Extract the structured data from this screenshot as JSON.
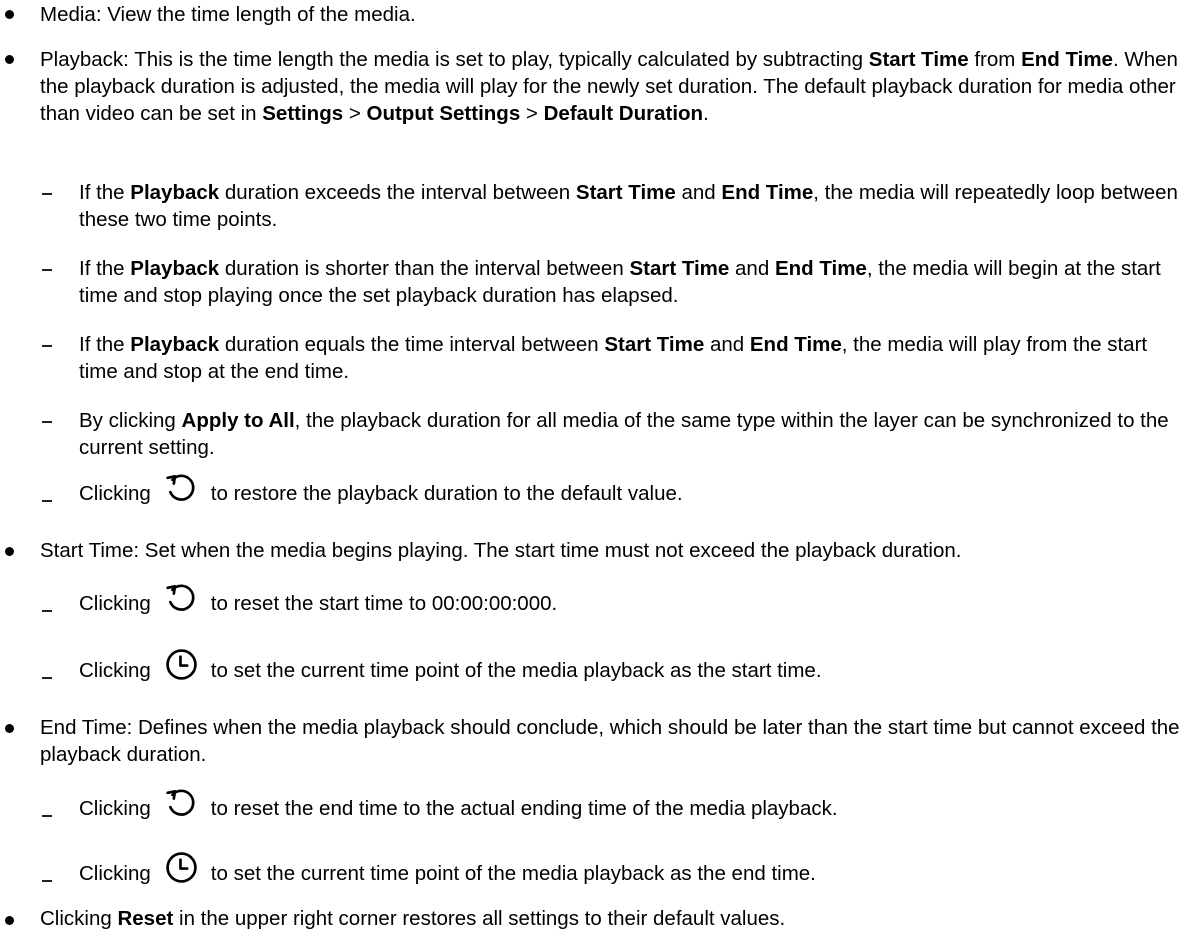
{
  "bullets": {
    "media": {
      "text": "Media: View the time length of the media."
    },
    "playback": {
      "p1": "Playback: This is the time length the media is set to play, typically calculated by subtracting ",
      "b1": "Start Time",
      "p2": " from ",
      "b2": "End Time",
      "p3": ". When the playback duration is adjusted, the media will play for the newly set duration. The default playback duration for media other than video can be set in ",
      "b3": "Settings",
      "p4": " > ",
      "b4": "Output Settings",
      "p5": " > ",
      "b5": "Default Duration",
      "p6": "."
    },
    "start_time": {
      "text": "Start Time: Set when the media begins playing. The start time must not exceed the playback duration."
    },
    "end_time": {
      "text": "End Time: Defines when the media playback should conclude, which should be later than the start time but cannot exceed the playback duration."
    },
    "reset": {
      "p1": "Clicking ",
      "b1": "Reset",
      "p2": " in the upper right corner restores all settings to their default values."
    }
  },
  "playback_items": {
    "exceeds": {
      "p1": "If the ",
      "b1": "Playback",
      "p2": " duration exceeds the interval between ",
      "b2": "Start Time",
      "p3": " and ",
      "b3": "End Time",
      "p4": ", the media will repeatedly loop between these two time points."
    },
    "shorter": {
      "p1": "If the ",
      "b1": "Playback",
      "p2": " duration is shorter than the interval between ",
      "b2": "Start Time",
      "p3": " and ",
      "b3": "End Time",
      "p4": ", the media will begin at the start time and stop playing once the set playback duration has elapsed."
    },
    "equals": {
      "p1": "If the ",
      "b1": "Playback",
      "p2": " duration equals the time interval between ",
      "b2": "Start Time",
      "p3": " and ",
      "b3": "End Time",
      "p4": ", the media will play from the start time and stop at the end time."
    },
    "apply_all": {
      "p1": "By clicking ",
      "b1": "Apply to All",
      "p2": ", the playback duration for all media of the same type within the layer can be synchronized to the current setting."
    },
    "restore": {
      "p1": "Clicking",
      "p2": "to restore the playback duration to the default value.",
      "icon": "reset-icon"
    }
  },
  "start_items": {
    "reset": {
      "p1": "Clicking",
      "p2": "to reset the start time to 00:00:00:000.",
      "icon": "reset-icon"
    },
    "current": {
      "p1": "Clicking",
      "p2": "to set the current time point of the media playback as the start time.",
      "icon": "clock-icon"
    }
  },
  "end_items": {
    "reset": {
      "p1": "Clicking",
      "p2": "to reset the end time to the actual ending time of the media playback.",
      "icon": "reset-icon"
    },
    "current": {
      "p1": "Clicking",
      "p2": "to set the current time point of the media playback as the end time.",
      "icon": "clock-icon"
    }
  }
}
